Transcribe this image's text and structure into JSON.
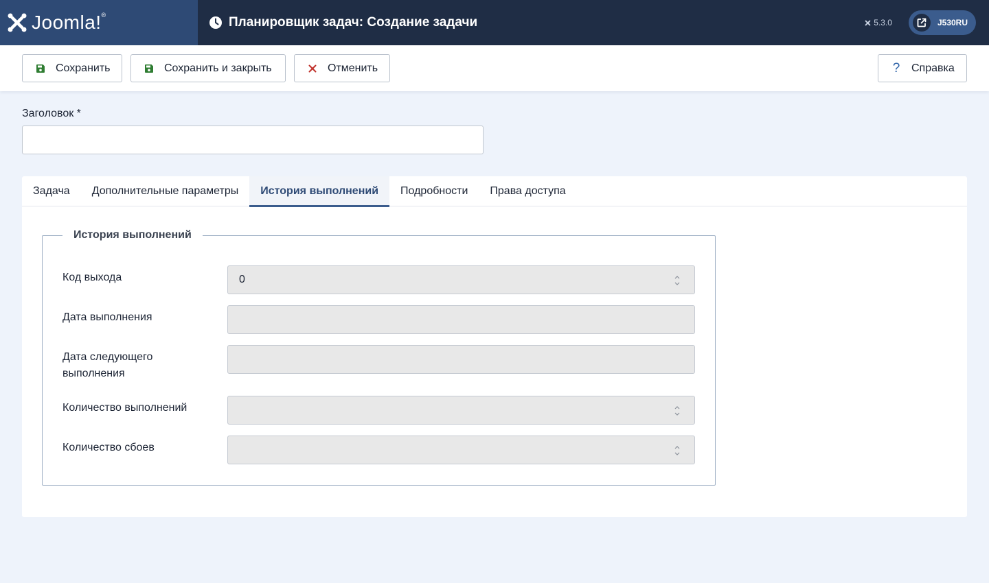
{
  "header": {
    "brand": "Joomla!",
    "page_title": "Планировщик задач: Создание задачи",
    "version": "5.3.0",
    "site_label": "J530RU"
  },
  "toolbar": {
    "save_label": "Сохранить",
    "save_close_label": "Сохранить и закрыть",
    "cancel_label": "Отменить",
    "help_label": "Справка"
  },
  "form": {
    "title_label": "Заголовок *",
    "title_value": ""
  },
  "tabs": [
    {
      "label": "Задача"
    },
    {
      "label": "Дополнительные параметры"
    },
    {
      "label": "История выполнений",
      "active": true
    },
    {
      "label": "Подробности"
    },
    {
      "label": "Права доступа"
    }
  ],
  "history": {
    "legend": "История выполнений",
    "fields": [
      {
        "label": "Код выхода",
        "value": "0"
      },
      {
        "label": "Дата выполнения",
        "value": ""
      },
      {
        "label": "Дата следующего выполнения",
        "value": ""
      },
      {
        "label": "Количество выполнений",
        "value": ""
      },
      {
        "label": "Количество сбоев",
        "value": ""
      }
    ]
  },
  "colors": {
    "header_bg": "#1f2d45",
    "brand_bg": "#2e4a75",
    "accent": "#3b5c8d",
    "save_icon": "#2f7d32",
    "cancel_icon": "#c0302a",
    "help_icon": "#2e63a8"
  }
}
